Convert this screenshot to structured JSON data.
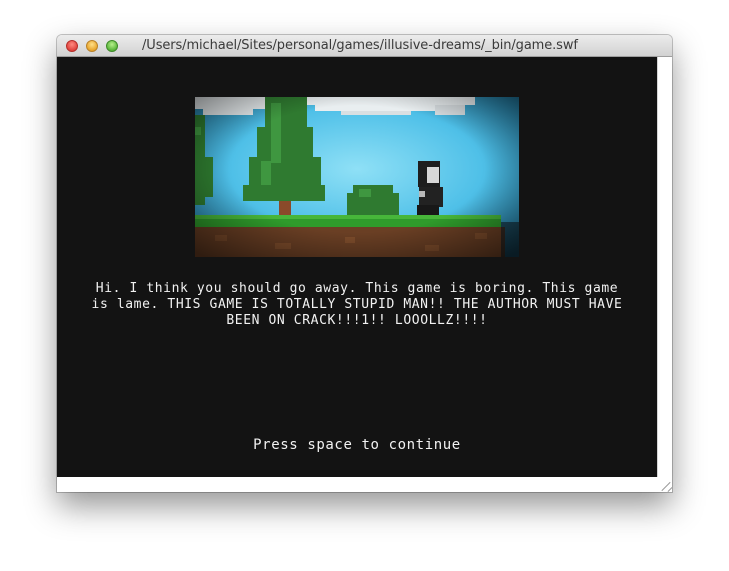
{
  "window": {
    "title": "/Users/michael/Sites/personal/games/illusive-dreams/_bin/game.swf"
  },
  "game": {
    "dialog_text": "Hi. I think you should go away. This game is boring. This game is lame. THIS GAME IS TOTALLY STUPID MAN!! THE AUTHOR MUST HAVE BEEN ON CRACK!!!1!! LOOOLLZ!!!!",
    "prompt": "Press space to continue"
  },
  "colors": {
    "stage_background": "#131313",
    "text": "#f2f2f2",
    "sky": "#5cc7ea",
    "grass": "#2f9b2b",
    "dirt": "#6a3f24",
    "tree": "#2f7a30"
  },
  "icons": [
    "close-light",
    "minimize-light",
    "zoom-light",
    "resize-grip-icon"
  ]
}
